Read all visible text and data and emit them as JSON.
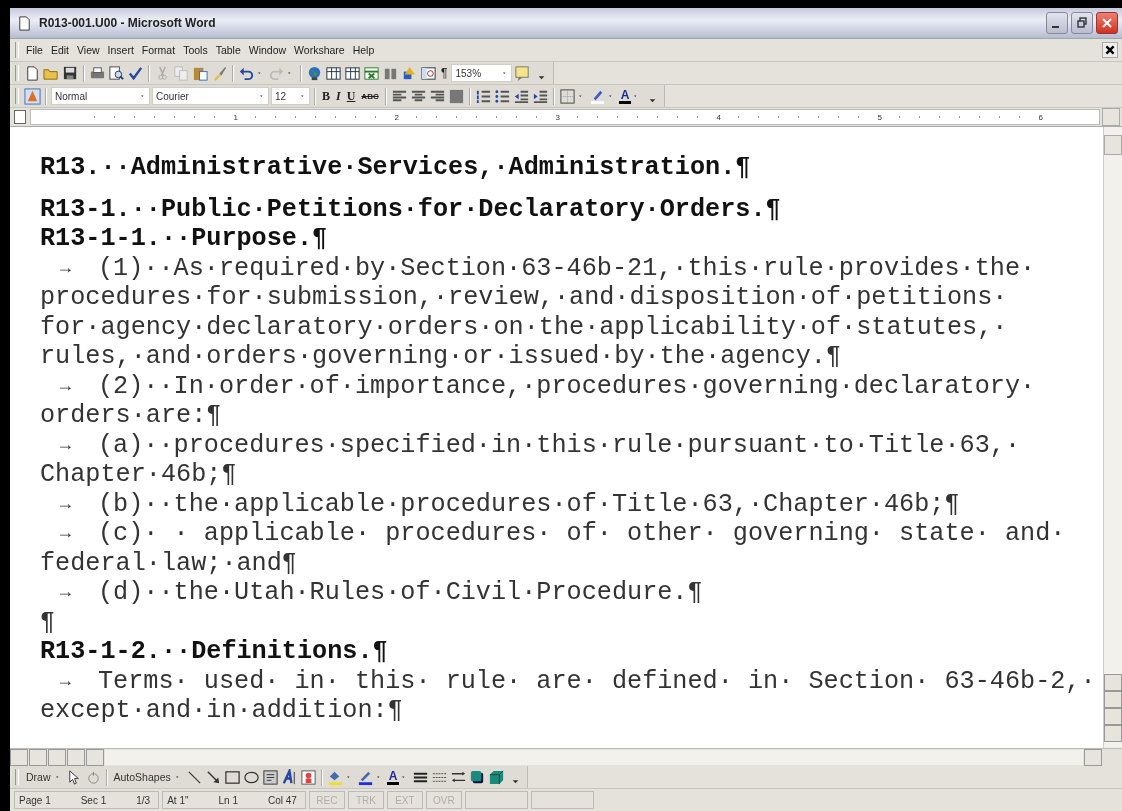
{
  "window": {
    "title": "R013-001.U00 - Microsoft Word"
  },
  "menu": [
    "File",
    "Edit",
    "View",
    "Insert",
    "Format",
    "Tools",
    "Table",
    "Window",
    "Workshare",
    "Help"
  ],
  "standard_toolbar": {
    "pilcrow": "¶",
    "zoom": "153%"
  },
  "formatting_toolbar": {
    "style": "Normal",
    "font": "Courier",
    "size": "12",
    "bold": "B",
    "italic": "I",
    "underline": "U",
    "strike": "ABC",
    "font_color_letter": "A"
  },
  "ruler": {
    "marks": [
      "1",
      "2",
      "3",
      "4",
      "5",
      "6"
    ]
  },
  "document": {
    "lines": [
      {
        "kind": "title",
        "text": "R13.··Administrative·Services,·Administration.¶"
      },
      {
        "kind": "heading",
        "text": "R13-1.··Public·Petitions·for·Declaratory·Orders.¶"
      },
      {
        "kind": "heading",
        "text": "R13-1-1.··Purpose.¶"
      },
      {
        "kind": "tab",
        "tab_mark": "→",
        "text": "(1)··As·required·by·Section·63-46b-21,·this·rule·provides·the·"
      },
      {
        "kind": "text",
        "text": "procedures·for·submission,·review,·and·disposition·of·petitions·"
      },
      {
        "kind": "text",
        "text": "for·agency·declaratory·orders·on·the·applicability·of·statutes,·"
      },
      {
        "kind": "text",
        "text": "rules,·and·orders·governing·or·issued·by·the·agency.¶"
      },
      {
        "kind": "tab",
        "tab_mark": "→",
        "text": "(2)··In·order·of·importance,·procedures·governing·declaratory·"
      },
      {
        "kind": "text",
        "text": "orders·are:¶"
      },
      {
        "kind": "tab",
        "tab_mark": "→",
        "text": "(a)··procedures·specified·in·this·rule·pursuant·to·Title·63,·"
      },
      {
        "kind": "text",
        "text": "Chapter·46b;¶"
      },
      {
        "kind": "tab",
        "tab_mark": "→",
        "text": "(b)··the·applicable·procedures·of·Title·63,·Chapter·46b;¶"
      },
      {
        "kind": "tab",
        "tab_mark": "→",
        "text": "(c)· · applicable· procedures· of· other· governing· state· and·"
      },
      {
        "kind": "text",
        "text": "federal·law;·and¶"
      },
      {
        "kind": "tab",
        "tab_mark": "→",
        "text": "(d)··the·Utah·Rules·of·Civil·Procedure.¶"
      },
      {
        "kind": "text",
        "text": "¶"
      },
      {
        "kind": "heading",
        "text": "R13-1-2.··Definitions.¶"
      },
      {
        "kind": "tab",
        "tab_mark": "→",
        "text": "Terms· used· in· this· rule· are· defined· in· Section· 63-46b-2,·"
      },
      {
        "kind": "text",
        "text": "except·and·in·addition:¶"
      }
    ]
  },
  "drawing_toolbar": {
    "draw": "Draw",
    "autoshapes": "AutoShapes",
    "font_color_letter": "A"
  },
  "status_bar": {
    "groups": [
      {
        "items": [
          "Page 1",
          "Sec 1",
          "1/3"
        ]
      },
      {
        "items": [
          "At 1\"",
          "Ln 1",
          "Col 47"
        ]
      }
    ],
    "modes": [
      {
        "label": "REC",
        "disabled": true
      },
      {
        "label": "TRK",
        "disabled": true
      },
      {
        "label": "EXT",
        "disabled": true
      },
      {
        "label": "OVR",
        "disabled": true
      }
    ]
  }
}
